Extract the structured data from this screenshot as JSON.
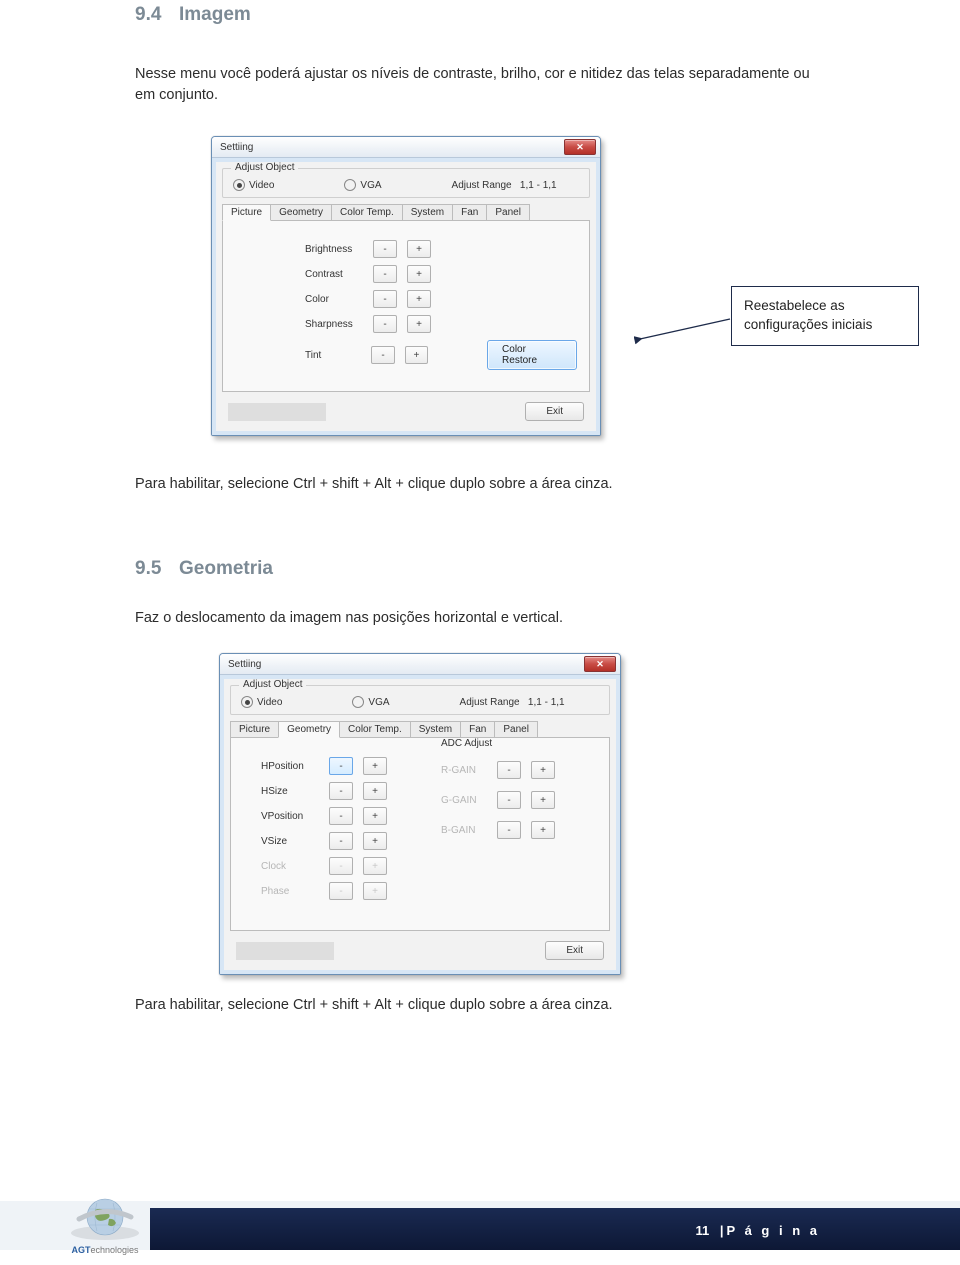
{
  "section1": {
    "num": "9.4",
    "title": "Imagem"
  },
  "intro1": "Nesse menu você poderá ajustar os níveis de contraste, brilho, cor e nitidez das telas separadamente ou em conjunto.",
  "note1": "Para habilitar, selecione Ctrl + shift + Alt + clique duplo sobre a área cinza.",
  "section2": {
    "num": "9.5",
    "title": "Geometria"
  },
  "intro2": "Faz o deslocamento da imagem nas posições horizontal e vertical.",
  "note2": "Para habilitar, selecione Ctrl + shift + Alt + clique duplo sobre a área cinza.",
  "callout": "Reestabelece as configurações iniciais",
  "dlg": {
    "title": "Settiing",
    "group": "Adjust Object",
    "radio_video": "Video",
    "radio_vga": "VGA",
    "range_lbl": "Adjust Range",
    "range_val": "1,1 - 1,1",
    "tabs": [
      "Picture",
      "Geometry",
      "Color Temp.",
      "System",
      "Fan",
      "Panel"
    ],
    "picture_rows": [
      "Brightness",
      "Contrast",
      "Color",
      "Sharpness",
      "Tint"
    ],
    "restore_btn": "Color Restore",
    "exit_btn": "Exit",
    "geom_rows": [
      "HPosition",
      "HSize",
      "VPosition",
      "VSize",
      "Clock",
      "Phase"
    ],
    "adc_hdr": "ADC Adjust",
    "adc_rows": [
      "R-GAIN",
      "G-GAIN",
      "B-GAIN"
    ]
  },
  "footer": {
    "page_num": "11",
    "page_label": "P á g i n a",
    "brand1": "AGT",
    "brand2": "echnologies"
  }
}
